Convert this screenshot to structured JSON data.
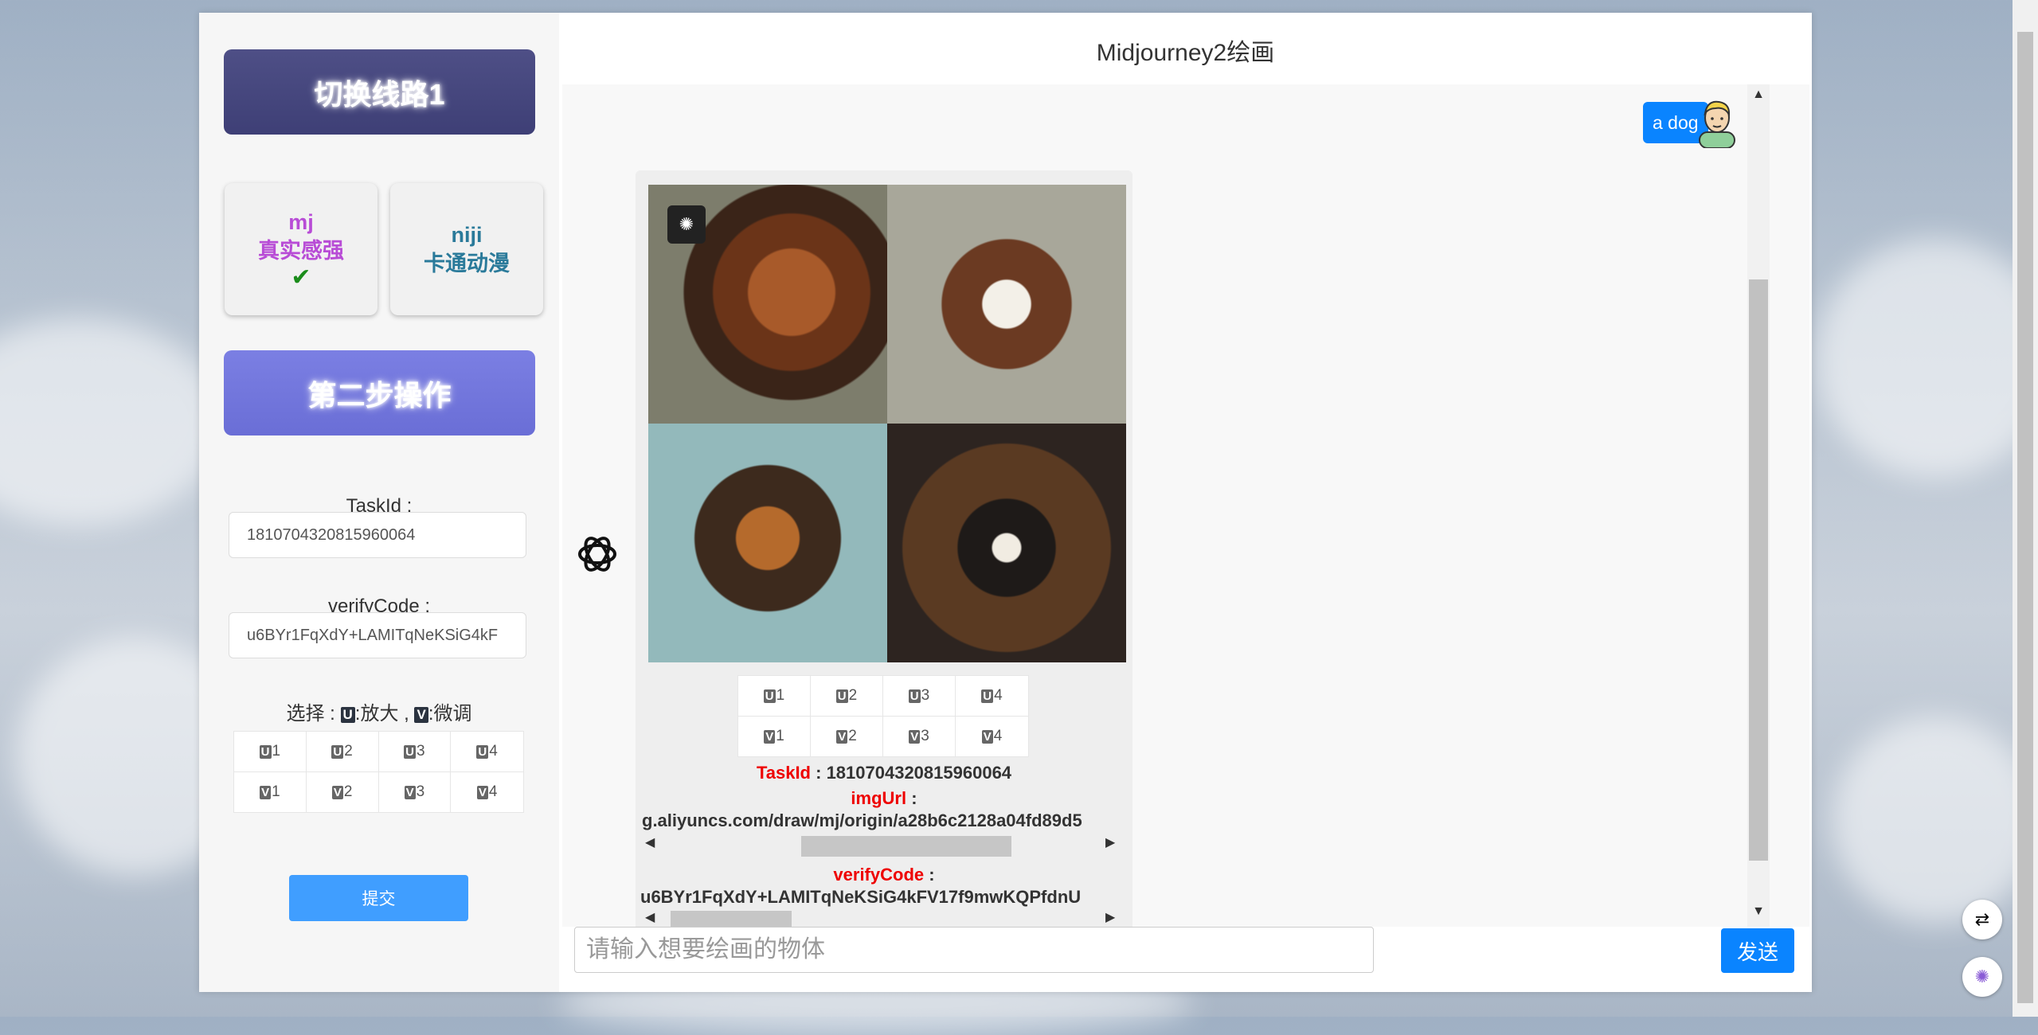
{
  "sidebar": {
    "route_button": "切换线路1",
    "modes": [
      {
        "name": "mj",
        "desc": "真实感强",
        "selected": true
      },
      {
        "name": "niji",
        "desc": "卡通动漫",
        "selected": false
      }
    ],
    "step_button": "第二步操作",
    "taskid_label": "TaskId :",
    "taskid_value": "1810704320815960064",
    "verify_label": "verifyCode :",
    "verify_value": "u6BYr1FqXdY+LAMITqNeKSiG4kF",
    "choose": {
      "prefix": "选择 :",
      "u_key": "U",
      "u_text": ":放大 ,",
      "v_key": "V",
      "v_text": ":微调"
    },
    "u_buttons": [
      "1",
      "2",
      "3",
      "4"
    ],
    "v_buttons": [
      "1",
      "2",
      "3",
      "4"
    ],
    "submit": "提交"
  },
  "main": {
    "title": "Midjourney2绘画",
    "user_message": "a dog",
    "card": {
      "u_buttons": [
        "1",
        "2",
        "3",
        "4"
      ],
      "v_buttons": [
        "1",
        "2",
        "3",
        "4"
      ],
      "taskid_label": "TaskId",
      "taskid_value": "1810704320815960064",
      "imgurl_label": "imgUrl",
      "imgurl_value": "g.aliyuncs.com/draw/mj/origin/a28b6c2128a04fd89d5",
      "verify_label": "verifyCode",
      "verify_value": "u6BYr1FqXdY+LAMITqNeKSiG4kFV17f9mwKQPfdnU"
    },
    "input_placeholder": "请输入想要绘画的物体",
    "send": "发送"
  },
  "colors": {
    "accent": "#0a84ff",
    "submit": "#409eff",
    "red_label": "#e00000",
    "mj_purple": "#b84cd6",
    "niji_teal": "#2a7a9a"
  },
  "icons": [
    "check-icon",
    "openai-icon",
    "user-avatar-icon",
    "brain-icon",
    "translate-icon"
  ]
}
